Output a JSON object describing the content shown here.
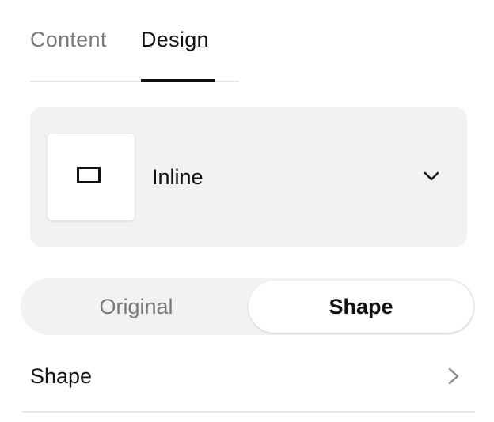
{
  "tabs": [
    {
      "label": "Content",
      "active": false
    },
    {
      "label": "Design",
      "active": true
    }
  ],
  "layout": {
    "selected_label": "Inline",
    "thumbnail_icon": "rectangle-outline-icon",
    "dropdown_icon": "chevron-down-icon"
  },
  "segmented": {
    "options": [
      {
        "label": "Original",
        "selected": false
      },
      {
        "label": "Shape",
        "selected": true
      }
    ]
  },
  "shape_row": {
    "label": "Shape",
    "icon": "chevron-right-icon"
  },
  "colors": {
    "text_primary": "#111111",
    "text_muted": "#7a7a7a",
    "panel_bg": "#f2f2f2",
    "divider": "#e6e6e6"
  }
}
